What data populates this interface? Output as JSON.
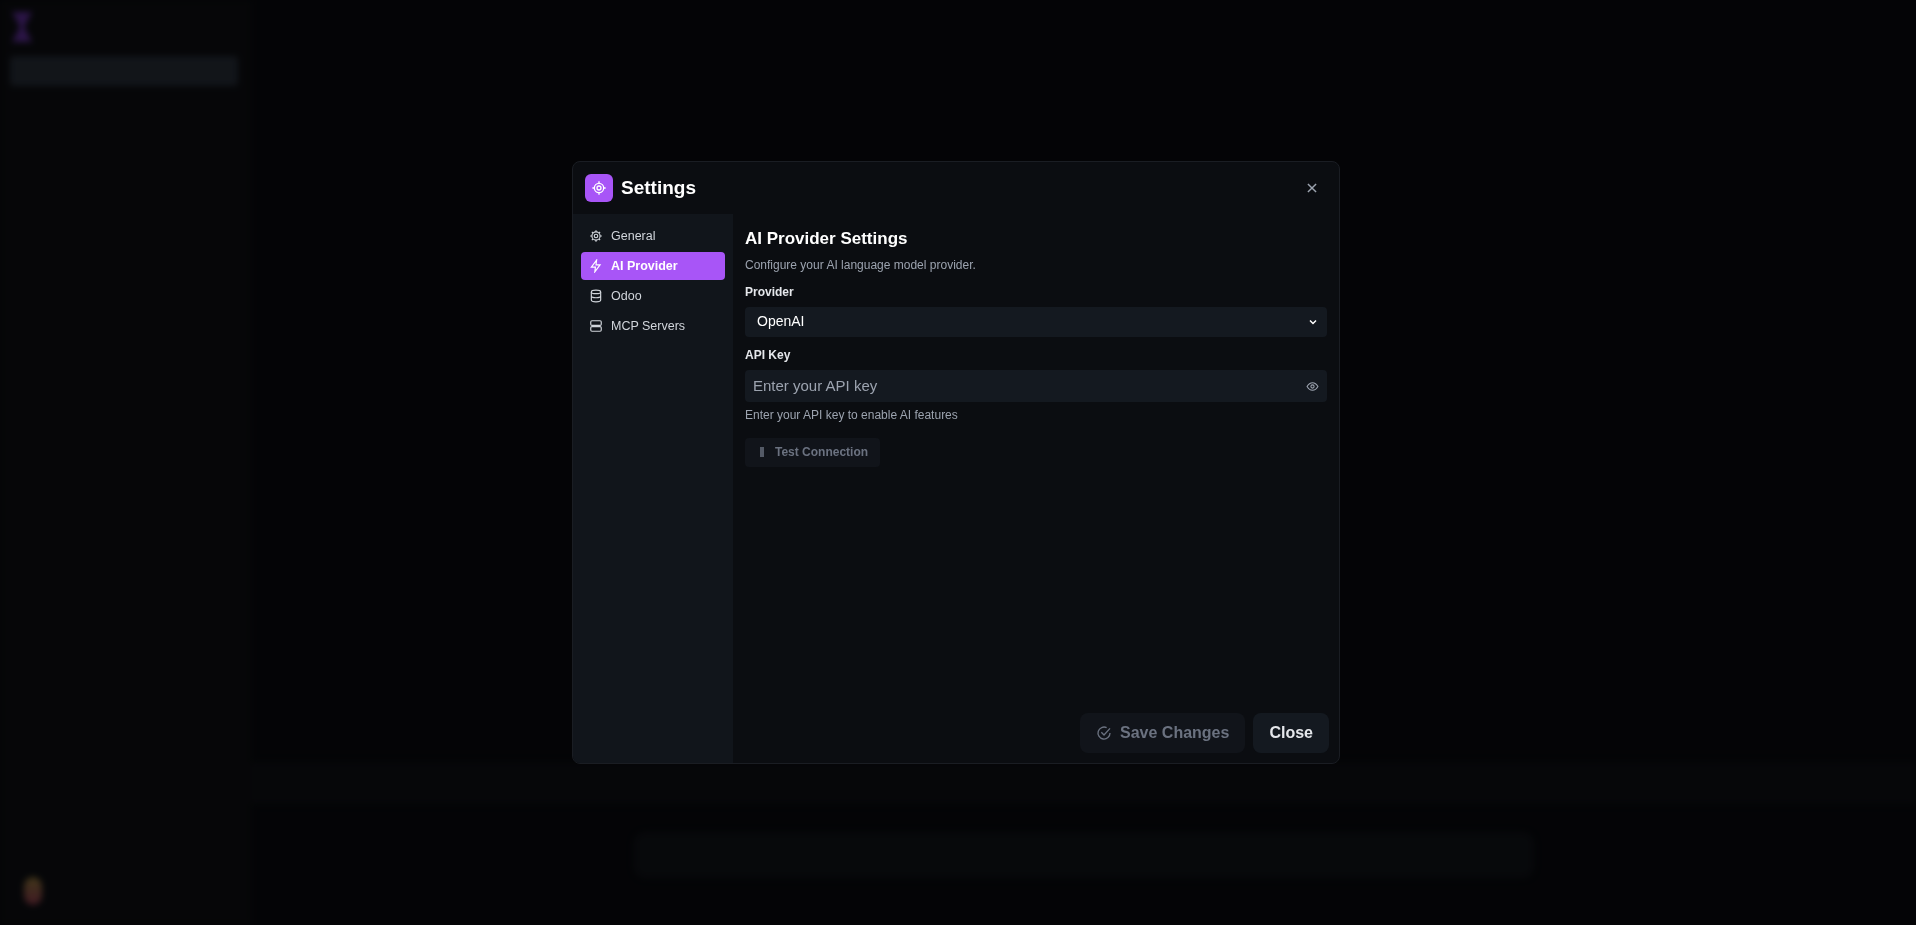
{
  "dialog": {
    "title": "Settings",
    "nav": [
      {
        "label": "General",
        "kind": "gear",
        "selected": false
      },
      {
        "label": "AI Provider",
        "kind": "bolt",
        "selected": true
      },
      {
        "label": "Odoo",
        "kind": "database",
        "selected": false
      },
      {
        "label": "MCP Servers",
        "kind": "server",
        "selected": false
      }
    ],
    "section": {
      "title": "AI Provider Settings",
      "description": "Configure your AI language model provider.",
      "provider": {
        "label": "Provider",
        "value": "OpenAI"
      },
      "api_key": {
        "label": "API Key",
        "placeholder": "Enter your API key",
        "hint": "Enter your API key to enable AI features"
      },
      "test_button": {
        "label": "Test Connection",
        "disabled": true
      }
    },
    "footer": {
      "save": {
        "label": "Save Changes",
        "disabled": true
      },
      "close": {
        "label": "Close"
      }
    }
  }
}
